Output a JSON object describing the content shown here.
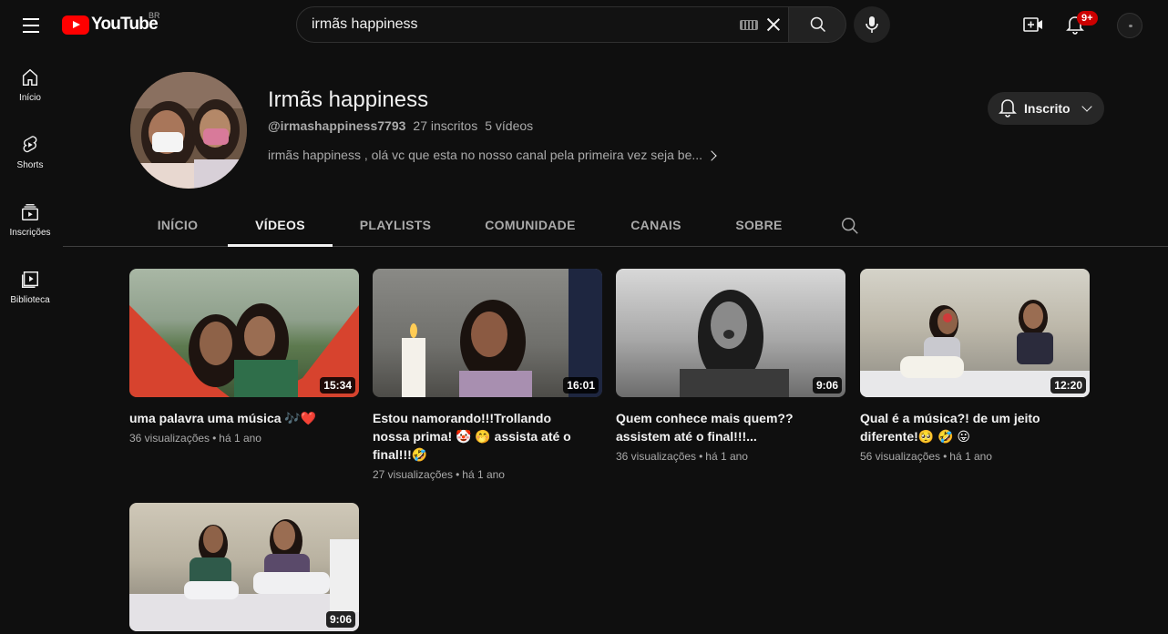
{
  "topbar": {
    "logo_text": "YouTube",
    "country_code": "BR",
    "search_value": "irmãs happiness",
    "notification_count": "9+"
  },
  "sidebar": {
    "items": [
      {
        "label": "Início",
        "icon": "home-icon"
      },
      {
        "label": "Shorts",
        "icon": "shorts-icon"
      },
      {
        "label": "Inscrições",
        "icon": "subscriptions-icon"
      },
      {
        "label": "Biblioteca",
        "icon": "library-icon"
      }
    ]
  },
  "channel": {
    "name": "Irmãs happiness",
    "handle": "@irmashappiness7793",
    "subscribers": "27 inscritos",
    "video_count": "5 vídeos",
    "description": "irmãs happiness , olá vc que esta no nosso canal pela primeira vez seja be...",
    "subscribe_label": "Inscrito"
  },
  "tabs": [
    {
      "label": "INÍCIO",
      "active": false
    },
    {
      "label": "VÍDEOS",
      "active": true
    },
    {
      "label": "PLAYLISTS",
      "active": false
    },
    {
      "label": "COMUNIDADE",
      "active": false
    },
    {
      "label": "CANAIS",
      "active": false
    },
    {
      "label": "SOBRE",
      "active": false
    }
  ],
  "videos": [
    {
      "title": "uma palavra uma música 🎶❤️",
      "views": "36 visualizações",
      "age": "há 1 ano",
      "duration": "15:34"
    },
    {
      "title": "Estou namorando!!!Trollando nossa prima! 🤡 🤭 assista até o final!!!🤣",
      "views": "27 visualizações",
      "age": "há 1 ano",
      "duration": "16:01"
    },
    {
      "title": "Quem conhece mais quem?? assistem até o final!!!...",
      "views": "36 visualizações",
      "age": "há 1 ano",
      "duration": "9:06"
    },
    {
      "title": "Qual é a música?! de um jeito diferente!🥺 🤣 😛",
      "views": "56 visualizações",
      "age": "há 1 ano",
      "duration": "12:20"
    },
    {
      "title": "",
      "views": "",
      "age": "",
      "duration": "9:06"
    }
  ],
  "colors": {
    "background": "#0f0f0f",
    "brand_red": "#ff0000",
    "badge_red": "#cc0000",
    "text_primary": "#f1f1f1",
    "text_secondary": "#aaaaaa"
  }
}
